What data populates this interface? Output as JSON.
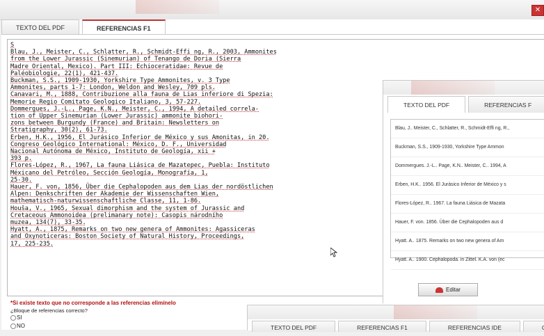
{
  "window": {
    "close_label": "✕"
  },
  "panel1": {
    "tabs": [
      {
        "label": "TEXTO DEL PDF",
        "active": false
      },
      {
        "label": "REFERENCIAS F1",
        "active": true
      }
    ],
    "references_text": [
      "S",
      "Blau, J., Meister, C., Schlatter, R., Schmidt-Effi ng, R., 2003, Ammonites",
      "from the Lower Jurassic (Sinemurian) of Tenango de Doria (Sierra",
      "Madre Oriental, Mexico). Part III: Echioceratidae: Revue de",
      "Paléobiologie, 22(1), 421-437.",
      "Buckman, S.S., 1909-1930, Yorkshire Type Ammonites, v. 3 Type",
      "Ammonites, parts 1-7: London, Weldon and Wesley, 709 pls.",
      "Canavari, M., 1888, Contribuzione alla fauna de Lias inferiore di Spezia:",
      "Memorie Regio Comitato Geologico Italiano, 3, 57-227.",
      "Dommergues, J.-L., Page, K.N., Meister, C., 1994, A detailed correla-",
      "tion of Upper Sinemurian (Lower Jurassic) ammonite biohori-",
      "zons between Burgundy (France) and Britain: Newsletters on",
      "Stratigraphy, 30(2), 61-73.",
      "Erben, H.K., 1956, El Jurásico Inferior de México y sus Amonitas, in 20.",
      "Congreso Geológico International: México, D. F., Universidad",
      "Nacional Autónoma de México, Instituto de Geología, xii +",
      "393 p.",
      "Flores-López, R., 1967, La fauna Liásica de Mazatepec, Puebla: Instituto",
      "Méxicano del Petróleo, Sección Geología, Monografía, 1,",
      "25-30.",
      "Hauer, F. von, 1856, Über die Cephalopoden aus dem Lias der nordöstlichen",
      "Alpen: Denkschriften der Akademie der Wissenschaften Wien,",
      "mathematisch-naturwissenschaftliche Classe, 11, 1-86.",
      "Houša, V., 1965, Sexual dimorphism and the system of Jurassic and",
      "Cretaceous Ammonoidea (prelimanary note): Casopis národního",
      "muzea, 134(7), 33-35.",
      "Hyatt, A., 1875, Remarks on two new genera of Ammonites: Agassiceras",
      "and Oxynoticeras: Boston Society of Natural History, Proceedings,",
      "17, 225-235."
    ],
    "warning": "*Si existe texto que no corresponde a las referencias elimínelo",
    "question": "¿Bloque de referencias correcto?",
    "options": [
      "SI",
      "NO"
    ]
  },
  "panel2": {
    "tabs": [
      {
        "label": "TEXTO DEL PDF",
        "active": true
      },
      {
        "label": "REFERENCIAS F",
        "active": false
      }
    ],
    "refs": [
      "Blau, J.. Meister, C., Schlatter, R., Schmidt-Effi ng, R.,",
      "Buckman, S.S., 1909-1930, Yorkshire Type Ammon",
      "Dommergues. J.-L.. Page, K.N.. Meister, C.. 1994, A",
      "Erben, H.K.. 1956. El Jurásico Inferior de México y s",
      "Flores-López, R.. 1967. La fauna Liásica de Mazata",
      "Hauer, F. von. 1856. Über die Cephalopoden aus d",
      "Hyatt. A.. 1875. Remarks on two new genera of Am",
      "Hyatt. A.. 1900. Cephalopoda. in Zittel. K.A. von (ec"
    ],
    "edit_label": "Editar"
  },
  "panel3": {
    "tabs": [
      {
        "label": "TEXTO DEL PDF",
        "active": false
      },
      {
        "label": "REFERENCIAS F1",
        "active": false
      },
      {
        "label": "REFERENCIAS IDE",
        "active": false
      },
      {
        "label": "CI",
        "active": true
      }
    ]
  }
}
